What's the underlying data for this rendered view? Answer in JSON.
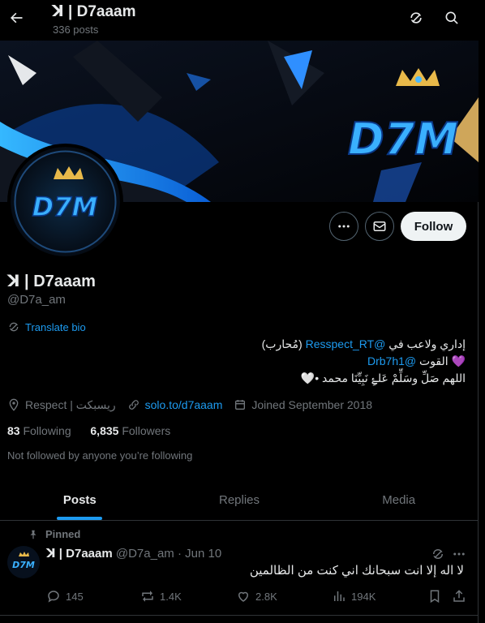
{
  "header": {
    "title": "ꓘ | D7aaam",
    "posts_count": "336 posts"
  },
  "profile": {
    "name": "ꓘ | D7aaam",
    "handle": "@D7a_am",
    "translate_bio": "Translate bio",
    "follow_label": "Follow",
    "bio": {
      "line1_prefix": "إداري ولاعب في ",
      "line1_mention": "@Resspect_RT",
      "line1_suffix": " (مُحارب)",
      "line2_prefix": "💜 القوت ",
      "line2_mention": "@Drb7h1",
      "line3": "اللهم صَلِّ وسَلِّمْ عَلۓِ نَبِيِّنَا محمد •🤍"
    },
    "location": "Respect | ريسبكت",
    "website": "solo.to/d7aaam",
    "joined": "Joined September 2018",
    "following_count": "83",
    "following_label": "Following",
    "followers_count": "6,835",
    "followers_label": "Followers",
    "not_followed": "Not followed by anyone you’re following",
    "avatar_logo": "D7M"
  },
  "tabs": [
    "Posts",
    "Replies",
    "Media"
  ],
  "active_tab": "Posts",
  "pinned_post": {
    "pinned_label": "Pinned",
    "author_name": "ꓘ | D7aaam",
    "author_handle": "@D7a_am · Jun 10",
    "text": "لا اله إلا انت سبحانك اني كنت من الظالمين",
    "replies": "145",
    "reposts": "1.4K",
    "likes": "2.8K",
    "views": "194K"
  },
  "colors": {
    "accent": "#1d9bf0",
    "background": "#000000",
    "muted_text": "#71767b"
  }
}
